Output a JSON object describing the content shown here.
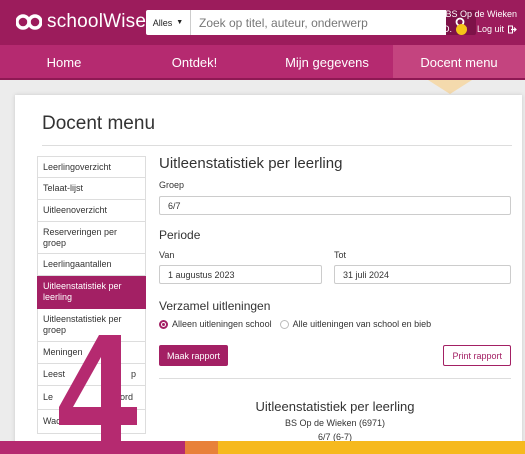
{
  "header": {
    "brand": "schoolWise",
    "search": {
      "scope": "Alles",
      "placeholder": "Zoek op titel, auteur, onderwerp"
    },
    "school_name": "BS Op de Wieken",
    "user_name": "Jannie D.",
    "logout_label": "Log uit"
  },
  "nav": {
    "items": [
      {
        "label": "Home"
      },
      {
        "label": "Ontdek!"
      },
      {
        "label": "Mijn gegevens"
      },
      {
        "label": "Docent menu"
      }
    ],
    "active": "Docent menu"
  },
  "page": {
    "title": "Docent menu"
  },
  "sidebar": {
    "items": [
      {
        "label": "Leerlingoverzicht"
      },
      {
        "label": "Telaat-lijst"
      },
      {
        "label": "Uitleenoverzicht"
      },
      {
        "label": "Reserveringen per groep"
      },
      {
        "label": "Leerlingaantallen"
      },
      {
        "label": "Uitleenstatistiek per leerling"
      },
      {
        "label": "Uitleenstatistiek per groep"
      },
      {
        "label": "Meningen"
      },
      {
        "label": "Leest"
      },
      {
        "label": "Le"
      },
      {
        "label": "Wachtwo"
      }
    ],
    "item_right_fragments": {
      "leest": "p",
      "le": "ord"
    },
    "active_index": 5
  },
  "form": {
    "title": "Uitleenstatistiek per leerling",
    "group_label": "Groep",
    "group_value": "6/7",
    "period_heading": "Periode",
    "from_label": "Van",
    "from_value": "1 augustus 2023",
    "to_label": "Tot",
    "to_value": "31 juli 2024",
    "collect_heading": "Verzamel uitleningen",
    "option_school": "Alleen uitleningen school",
    "option_all": "Alle uitleningen van school en bieb",
    "selected_option": "option_school",
    "make_report_label": "Maak rapport",
    "print_report_label": "Print rapport"
  },
  "report": {
    "title": "Uitleenstatistiek per leerling",
    "school": "BS Op de Wieken (6971)",
    "group": "6/7 (6-7)"
  },
  "overlay": {
    "digit": "4"
  },
  "colors": {
    "brand": "#9c1c5c",
    "nav": "#b52a70",
    "accent": "#a32064",
    "stripe": [
      "#b52a70",
      "#e8813a",
      "#f6b91e"
    ]
  }
}
